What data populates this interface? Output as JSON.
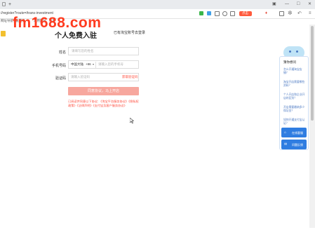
{
  "browser": {
    "new_tab_glyph": "+",
    "url": "//register?route=/trans-investment",
    "promo_badge": "点击",
    "minimize_glyph": "—",
    "maximize_glyph": "□",
    "close_glyph": "✕"
  },
  "bookmarks": {
    "items": [
      "网址导航",
      "收藏夹",
      "常用网址",
      "百度"
    ]
  },
  "watermark": {
    "text": "fm1688.com",
    "color": "#ff3b1f"
  },
  "page": {
    "title": "个人免费入驻",
    "login_link": "已有淘宝账号去登录",
    "form": {
      "name_label": "姓名",
      "name_placeholder": "请填写您的姓名",
      "phone_label": "手机号码",
      "country_value": "中国大陆",
      "country_code": "+86",
      "phone_placeholder": "请输入您的手机号",
      "code_label": "验证码",
      "code_placeholder": "请输入验证码",
      "get_code_label": "获取验证码",
      "submit_label": "同意协议，马上开店",
      "agreement_text": "已阅读并同意以下协议: 《淘宝平台服务协议》《隐私权政策》《法律声明》《支付宝及客户服务协议》"
    }
  },
  "help_panel": {
    "title": "猜你想问",
    "questions": [
      "怎么开通淘宝店铺？",
      "淘宝开店需要哪些资料？",
      "个人开店和企业开店的区别？",
      "开店需要缴纳多少保证金？",
      "如何开通支付宝认证？"
    ],
    "chat_label": "在线客服",
    "feedback_label": "问题反馈"
  },
  "colors": {
    "accent_red": "#ff4a3a",
    "submit_bg": "#f7a79e",
    "panel_blue": "#2f7de1"
  }
}
